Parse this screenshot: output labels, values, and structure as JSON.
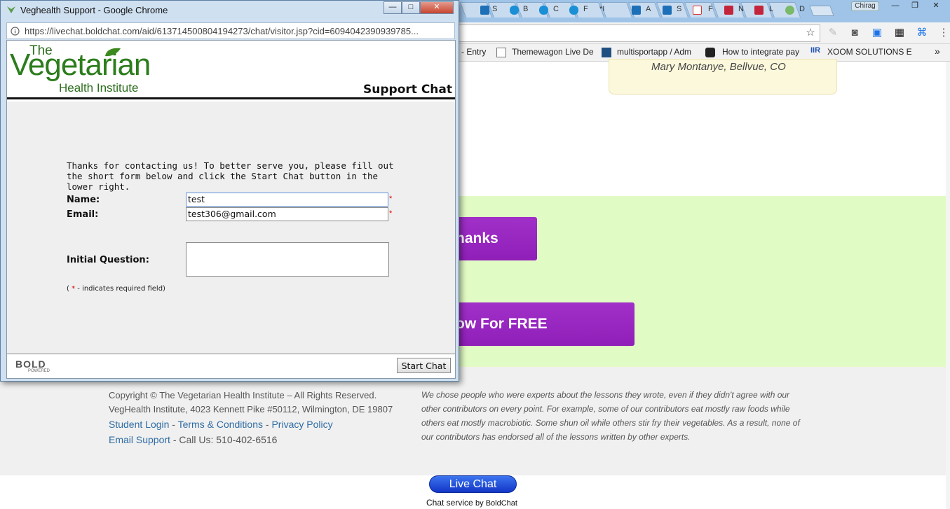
{
  "window": {
    "title": "Veghealth Support - Google Chrome",
    "url": "https://livechat.boldchat.com/aid/613714500804194273/chat/visitor.jsp?cid=6094042390939785...",
    "controls": {
      "minimize": "—",
      "maximize": "□",
      "close": "✕"
    }
  },
  "chat": {
    "logo": {
      "the": "The",
      "vegetarian": "Vegetarian",
      "health": "Health Institute"
    },
    "header": "Support Chat",
    "intro": "Thanks for contacting us! To better serve you, please fill out the short form below and click the Start Chat button in the lower right.",
    "name_label": "Name:",
    "name_value": "test",
    "email_label": "Email:",
    "email_value": "test306@gmail.com",
    "question_label": "Initial Question:",
    "required_star": "*",
    "required_note_open": "(",
    "required_note_star": "*",
    "required_note_text": "- indicates required field)",
    "bold_logo": "BOLD",
    "bold_powered": "POWERED",
    "start_button": "Start Chat"
  },
  "background": {
    "user": "Chirag",
    "tabs": [
      "S",
      "B",
      "C",
      "F",
      "*I",
      "A",
      "S",
      "F",
      "N",
      "L",
      "D"
    ],
    "bookmarks": [
      {
        "label": "- Entry"
      },
      {
        "label": "Themewagon Live De"
      },
      {
        "label": "multisportapp / Adm"
      },
      {
        "label": "How to integrate pay"
      },
      {
        "label": "XOOM SOLUTIONS E"
      }
    ],
    "bookmarks_more": "»",
    "testimonial": "Mary Montanye, Bellvue, CO",
    "thanks_button": "hanks",
    "free_button": "ow For FREE",
    "footer": {
      "copyright": "Copyright © The Vegetarian Health Institute – All Rights Reserved.",
      "address": "VegHealth Institute, 4023 Kennett Pike #50112, Wilmington, DE 19807",
      "student_login": "Student Login",
      "sep1": " - ",
      "terms": "Terms & Conditions",
      "sep2": " - ",
      "privacy": "Privacy Policy",
      "email_support": "Email Support",
      "phone": " - Call Us: 510-402-6516",
      "para": [
        "We chose people who were experts about the lessons they wrote, even if they didn't agree with our",
        "other contributors on every point. For example, some of our contributors eat mostly raw foods while",
        "others eat mostly macrobiotic. Some shun oil while others stir fry their vegetables. As a result, none of",
        "our contributors has endorsed all of the lessons written by other experts."
      ]
    },
    "live_chat": "Live Chat",
    "chat_service": "Chat service",
    "chat_service_by": "by BoldChat"
  },
  "colors": {
    "accent_purple": "#9a28c4",
    "green_band": "#e1fbc4",
    "logo_green": "#2c7d1c"
  }
}
